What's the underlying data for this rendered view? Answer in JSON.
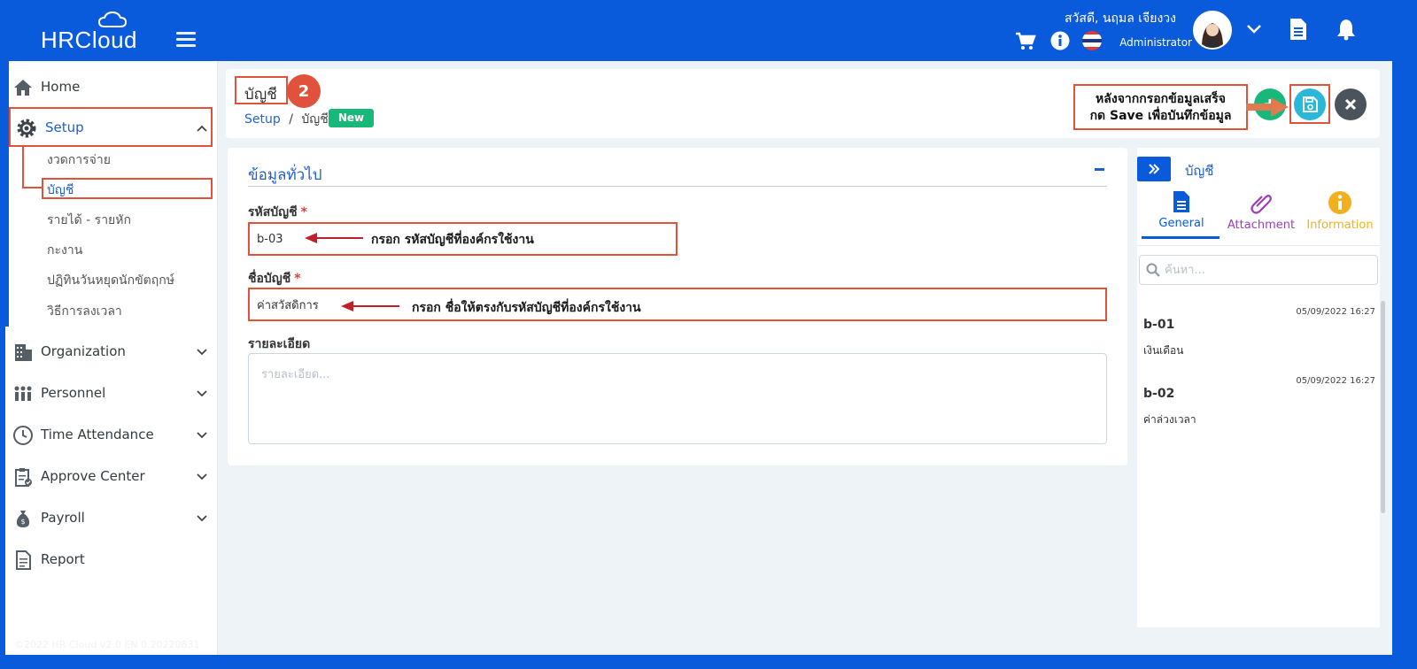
{
  "header": {
    "logo_text": "HRCloud",
    "greeting": "สวัสดี, นฤมล เจียงวง",
    "role": "Administrator"
  },
  "sidebar": {
    "items": [
      {
        "label": "Home",
        "icon": "home-icon"
      },
      {
        "label": "Setup",
        "icon": "gear-icon"
      },
      {
        "label": "Organization",
        "icon": "building-icon"
      },
      {
        "label": "Personnel",
        "icon": "people-icon"
      },
      {
        "label": "Time Attendance",
        "icon": "clock-icon"
      },
      {
        "label": "Approve Center",
        "icon": "clipboard-icon"
      },
      {
        "label": "Payroll",
        "icon": "money-bag-icon"
      },
      {
        "label": "Report",
        "icon": "document-icon"
      }
    ],
    "setup_sub": [
      "งวดการจ่าย",
      "บัญชี",
      "รายได้ - รายหัก",
      "กะงาน",
      "ปฏิทินวันหยุดนักขัตฤกษ์",
      "วิธีการลงเวลา"
    ],
    "copyright": "©2022 HR Cloud v2.0 EN 0.20220831"
  },
  "page": {
    "title": "บัญชี",
    "step_badge": "2",
    "breadcrumb_root": "Setup",
    "breadcrumb_sep": "/",
    "breadcrumb_current": "บัญชี",
    "status_badge": "New",
    "callout_line1": "หลังจากกรอกข้อมูลเสร็จ",
    "callout_line2": "กด Save เพื่อบันทึกข้อมูล"
  },
  "form": {
    "section_title": "ข้อมูลทั่วไป",
    "code_label": "รหัสบัญชี",
    "code_value": "b-03",
    "code_note": "กรอก รหัสบัญชีที่องค์กรใช้งาน",
    "name_label": "ชื่อบัญชี",
    "name_value": "ค่าสวัสดิการ",
    "name_note": "กรอก ชื่อให้ตรงกับรหัสบัญชีที่องค์กรใช้งาน",
    "required_mark": "*",
    "detail_label": "รายละเอียด",
    "detail_placeholder": "รายละเอียด..."
  },
  "right_panel": {
    "title": "บัญชี",
    "tabs": [
      {
        "label": "General",
        "color": "#0a5bdb"
      },
      {
        "label": "Attachment",
        "color": "#9b3fb6"
      },
      {
        "label": "Information",
        "color": "#f2b01e"
      }
    ],
    "search_placeholder": "ค้นหา...",
    "records": [
      {
        "code": "b-01",
        "date": "05/09/2022 16:27",
        "name": "เงินเดือน"
      },
      {
        "code": "b-02",
        "date": "05/09/2022 16:27",
        "name": "ค่าล่วงเวลา"
      }
    ]
  },
  "colors": {
    "brand": "#0a5bdb",
    "annotation": "#e0523b",
    "new_badge": "#18b87a",
    "save": "#2bb7d8",
    "close": "#4b545c"
  }
}
